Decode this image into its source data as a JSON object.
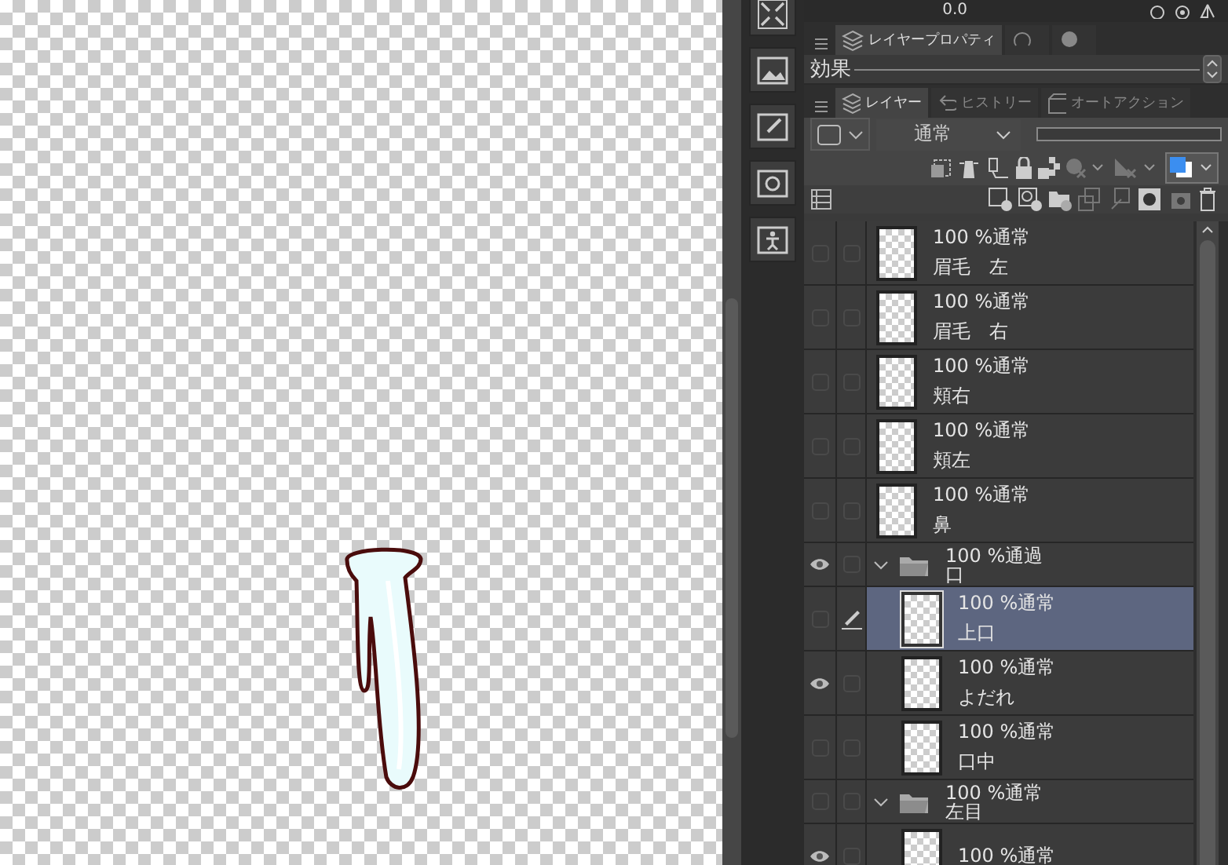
{
  "navigator": {
    "reading": "0.0"
  },
  "property_tabs": [
    {
      "label": "レイヤープロパティ",
      "selected": true
    }
  ],
  "effect_section": {
    "label": "効果"
  },
  "panel_tabs": [
    {
      "label": "レイヤー",
      "selected": true
    },
    {
      "label": "ヒストリー",
      "selected": false
    },
    {
      "label": "オートアクション",
      "selected": false
    }
  ],
  "blend_mode": {
    "value": "通常"
  },
  "opacity_slider": {
    "level": 1
  },
  "layers": [
    {
      "kind": "layer",
      "visible": false,
      "editing": false,
      "selected": false,
      "opacity_blend": "100 %通常",
      "name": "眉毛　左"
    },
    {
      "kind": "layer",
      "visible": false,
      "editing": false,
      "selected": false,
      "opacity_blend": "100 %通常",
      "name": "眉毛　右"
    },
    {
      "kind": "layer",
      "visible": false,
      "editing": false,
      "selected": false,
      "opacity_blend": "100 %通常",
      "name": "頬右"
    },
    {
      "kind": "layer",
      "visible": false,
      "editing": false,
      "selected": false,
      "opacity_blend": "100 %通常",
      "name": "頬左"
    },
    {
      "kind": "layer",
      "visible": false,
      "editing": false,
      "selected": false,
      "opacity_blend": "100 %通常",
      "name": "鼻"
    },
    {
      "kind": "folder",
      "visible": true,
      "editing": false,
      "selected": false,
      "expanded": true,
      "opacity_blend": "100 %通過",
      "name": "口",
      "children": [
        {
          "kind": "layer",
          "visible": false,
          "editing": true,
          "selected": true,
          "opacity_blend": "100 %通常",
          "name": "上口"
        },
        {
          "kind": "layer",
          "visible": true,
          "editing": false,
          "selected": false,
          "opacity_blend": "100 %通常",
          "name": "よだれ"
        },
        {
          "kind": "layer",
          "visible": false,
          "editing": false,
          "selected": false,
          "opacity_blend": "100 %通常",
          "name": "口中"
        }
      ]
    },
    {
      "kind": "folder",
      "visible": false,
      "editing": false,
      "selected": false,
      "expanded": true,
      "opacity_blend": "100 %通常",
      "name": "左目",
      "children": [
        {
          "kind": "layer",
          "visible": true,
          "editing": false,
          "selected": false,
          "opacity_blend": "100 %通常"
        }
      ]
    }
  ]
}
